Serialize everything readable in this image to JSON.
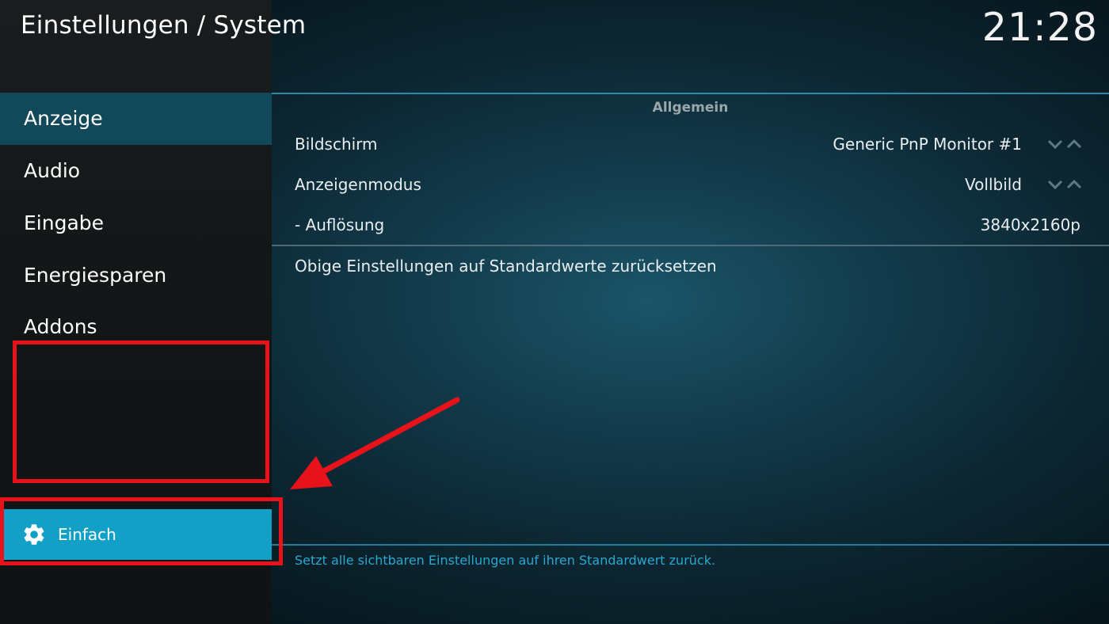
{
  "header": {
    "title": "Einstellungen / System",
    "clock": "21:28"
  },
  "sidebar": {
    "items": [
      {
        "label": "Anzeige",
        "active": true
      },
      {
        "label": "Audio",
        "active": false
      },
      {
        "label": "Eingabe",
        "active": false
      },
      {
        "label": "Energiesparen",
        "active": false
      },
      {
        "label": "Addons",
        "active": false
      }
    ],
    "level_button": {
      "label": "Einfach",
      "icon": "gear-icon"
    }
  },
  "main": {
    "section_header": "Allgemein",
    "settings": [
      {
        "label": "Bildschirm",
        "value": "Generic PnP Monitor #1",
        "spinner": true
      },
      {
        "label": "Anzeigenmodus",
        "value": "Vollbild",
        "spinner": true
      },
      {
        "label": "- Auflösung",
        "value": "3840x2160p",
        "spinner": false
      }
    ],
    "reset_label": "Obige Einstellungen auf Standardwerte zurücksetzen",
    "help_text": "Setzt alle sichtbaren Einstellungen auf ihren Standardwert zurück."
  },
  "colors": {
    "accent": "#12a0c6",
    "active_item": "#12495a",
    "annotation": "#e8121a",
    "help_text": "#2aa7cf"
  }
}
